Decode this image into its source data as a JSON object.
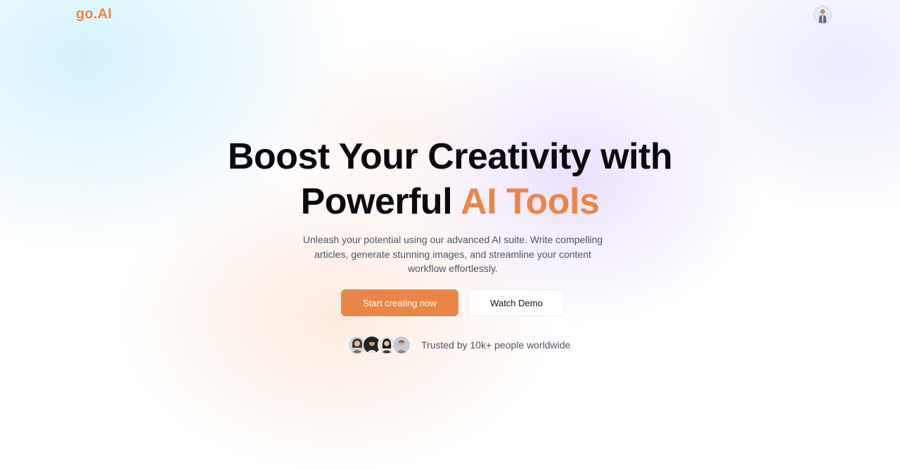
{
  "header": {
    "logo": "go.AI",
    "user_avatar": "user-avatar"
  },
  "hero": {
    "title_line1": "Boost Your Creativity with",
    "title_line2_plain": "Powerful",
    "title_line2_accent": "AI Tools",
    "subtitle": "Unleash your potential using our advanced AI suite. Write compelling articles, generate stunning images, and streamline your content workflow effortlessly.",
    "cta_primary": "Start creating now",
    "cta_secondary": "Watch Demo"
  },
  "social_proof": {
    "text": "Trusted by 10k+ people worldwide",
    "avatars": [
      "user-avatar-1",
      "user-avatar-2",
      "user-avatar-3",
      "user-avatar-4"
    ]
  },
  "colors": {
    "accent": "#ea8548",
    "heading": "#0b0b0f",
    "body_text": "#4b5563",
    "background": "#ffffff"
  }
}
